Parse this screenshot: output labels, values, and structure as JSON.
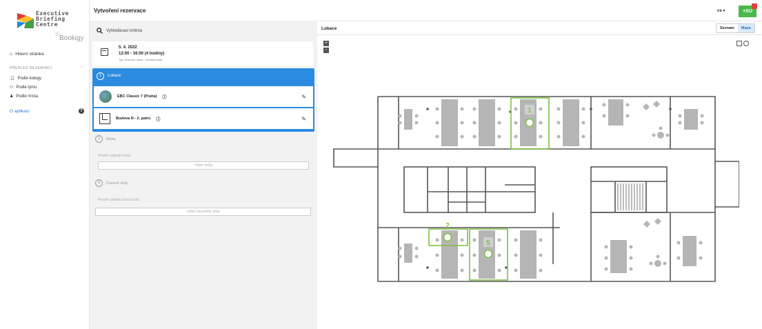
{
  "sidebar": {
    "logo_lines": [
      "Executive",
      "Briefing",
      "Centre"
    ],
    "brand": "Bookigy",
    "home": "Hlavní stránka",
    "section": "PŘEHLED REZERVACÍ",
    "items": [
      {
        "label": "Podle kolegy"
      },
      {
        "label": "Podle týmu"
      },
      {
        "label": "Podle místa"
      }
    ],
    "about": "O aplikaci"
  },
  "header": {
    "title": "Vytvoření rezervace",
    "lang": "cs",
    "add_label": "+SU"
  },
  "search": {
    "label": "Vyhledávací kritéria"
  },
  "date_card": {
    "date": "5. 4. 2022",
    "time": "12:00 - 16:00 (4 hodiny)",
    "type": "Typ: Pracovní místo - Kombinované"
  },
  "steps": [
    {
      "num": "1",
      "label": "Lokace"
    },
    {
      "num": "2",
      "label": "Místa",
      "hint": "Prosím vyberte místo",
      "button": "Výběr místa"
    },
    {
      "num": "3",
      "label": "Časové sloty",
      "hint": "Prosím vyberte časový slot",
      "button": "Výběr časového slotu"
    }
  ],
  "locations": [
    {
      "label": "EBC Classic 7 (Praha)"
    },
    {
      "label": "Budova N - 2. patro"
    }
  ],
  "map_panel": {
    "title": "Lokace",
    "toggle": [
      "Seznam",
      "Mapa"
    ],
    "active_toggle": "Mapa",
    "zoom_in": "+",
    "zoom_out": "-",
    "markers": [
      "1",
      "2",
      "5"
    ]
  },
  "colors": {
    "accent": "#2a8be0",
    "green": "#7dc142",
    "add_button": "#4bb84b"
  }
}
